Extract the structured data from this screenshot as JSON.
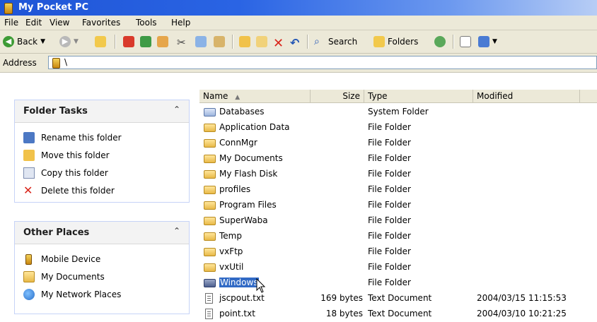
{
  "window": {
    "title": "My Pocket PC"
  },
  "menu": [
    "File",
    "Edit",
    "View",
    "Favorites",
    "Tools",
    "Help"
  ],
  "toolbar": {
    "back": "Back",
    "search": "Search",
    "folders": "Folders"
  },
  "address": {
    "label": "Address",
    "value": "\\"
  },
  "folder_tasks": {
    "title": "Folder Tasks",
    "items": [
      "Rename this folder",
      "Move this folder",
      "Copy this folder",
      "Delete this folder"
    ]
  },
  "other_places": {
    "title": "Other Places",
    "items": [
      "Mobile Device",
      "My Documents",
      "My Network Places"
    ]
  },
  "columns": {
    "name": "Name",
    "size": "Size",
    "type": "Type",
    "modified": "Modified"
  },
  "files": [
    {
      "name": "Databases",
      "size": "",
      "type": "System Folder",
      "modified": ""
    },
    {
      "name": "Application Data",
      "size": "",
      "type": "File Folder",
      "modified": ""
    },
    {
      "name": "ConnMgr",
      "size": "",
      "type": "File Folder",
      "modified": ""
    },
    {
      "name": "My Documents",
      "size": "",
      "type": "File Folder",
      "modified": ""
    },
    {
      "name": "My Flash Disk",
      "size": "",
      "type": "File Folder",
      "modified": ""
    },
    {
      "name": "profiles",
      "size": "",
      "type": "File Folder",
      "modified": ""
    },
    {
      "name": "Program Files",
      "size": "",
      "type": "File Folder",
      "modified": ""
    },
    {
      "name": "SuperWaba",
      "size": "",
      "type": "File Folder",
      "modified": ""
    },
    {
      "name": "Temp",
      "size": "",
      "type": "File Folder",
      "modified": ""
    },
    {
      "name": "vxFtp",
      "size": "",
      "type": "File Folder",
      "modified": ""
    },
    {
      "name": "vxUtil",
      "size": "",
      "type": "File Folder",
      "modified": ""
    },
    {
      "name": "Windows",
      "size": "",
      "type": "File Folder",
      "modified": ""
    },
    {
      "name": "jscpout.txt",
      "size": "169 bytes",
      "type": "Text Document",
      "modified": "2004/03/15  11:15:53"
    },
    {
      "name": "point.txt",
      "size": "18 bytes",
      "type": "Text Document",
      "modified": "2004/03/10  10:21:25"
    }
  ]
}
